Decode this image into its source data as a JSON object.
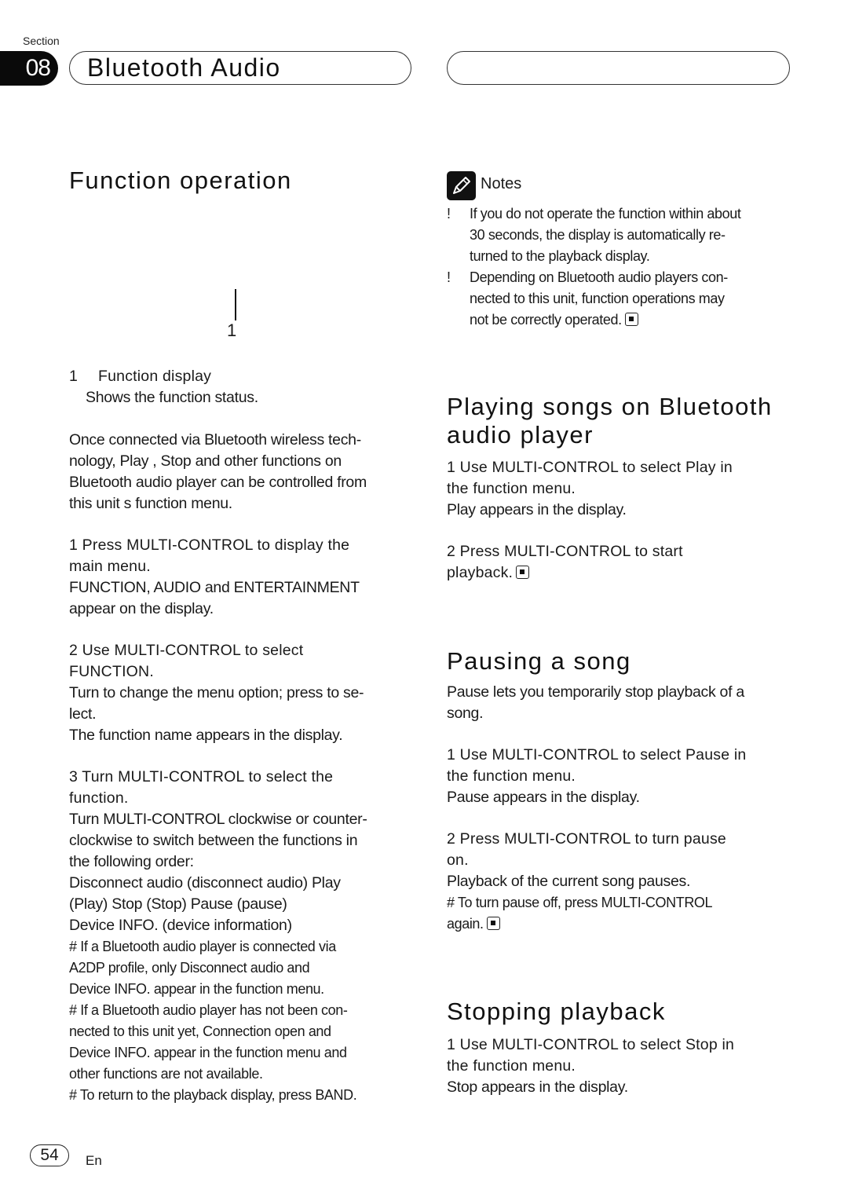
{
  "header": {
    "section_label": "Section",
    "section_number": "08",
    "title": "Bluetooth Audio"
  },
  "left": {
    "heading": "Function operation",
    "figure_callout": "1",
    "legend": {
      "number": "1",
      "label": "Function display",
      "description": "Shows the function status."
    },
    "intro": [
      "Once connected via Bluetooth wireless tech-",
      "nology,  Play ,  Stop  and other functions on",
      "Bluetooth audio player can be controlled from",
      "this unit s function menu."
    ],
    "step1": {
      "lines": [
        "1    Press MULTI-CONTROL to display the",
        "main menu."
      ],
      "desc": [
        "FUNCTION, AUDIO and ENTERTAINMENT",
        "appear on the display."
      ]
    },
    "step2": {
      "lines": [
        "2    Use MULTI-CONTROL to select",
        "FUNCTION."
      ],
      "desc": [
        "Turn to change the menu option; press to se-",
        "lect.",
        "The function name appears in the display."
      ]
    },
    "step3": {
      "lines": [
        "3    Turn MULTI-CONTROL to select the",
        "function."
      ],
      "desc": [
        "Turn MULTI-CONTROL clockwise or counter-",
        "clockwise to switch between the functions in",
        "the following order:",
        "Disconnect audio (disconnect audio)    Play",
        "(Play)    Stop (Stop)    Pause (pause)",
        "Device INFO. (device information)"
      ]
    },
    "tips": [
      "#   If a Bluetooth audio player is connected via",
      "A2DP profile, only Disconnect audio and",
      "Device INFO. appear in the function menu.",
      "#   If a Bluetooth audio player has not been con-",
      "nected to this unit yet, Connection open and",
      "Device INFO. appear in the function menu and",
      "other functions are not available.",
      "#   To return to the playback display, press BAND."
    ]
  },
  "right": {
    "notes": {
      "title": "Notes",
      "icon": "pencil-icon",
      "bullet": "!",
      "items": [
        [
          "If you do not operate the function within about",
          "30 seconds, the display is automatically re-",
          "turned to the playback display."
        ],
        [
          "Depending on Bluetooth audio players con-",
          "nected to this unit, function operations may",
          "not be correctly operated."
        ]
      ]
    },
    "playing": {
      "heading": [
        "Playing songs on Bluetooth",
        "audio player"
      ],
      "step1": [
        "1    Use MULTI-CONTROL to select Play in",
        "the function menu."
      ],
      "step1_desc": "Play appears in the display.",
      "step2": [
        "2    Press MULTI-CONTROL to start",
        "playback."
      ]
    },
    "pausing": {
      "heading": "Pausing a song",
      "intro": [
        "Pause lets you temporarily stop playback of a",
        "song."
      ],
      "step1": [
        "1    Use MULTI-CONTROL to select Pause in",
        "the function menu."
      ],
      "step1_desc": "Pause appears in the display.",
      "step2": [
        "2    Press MULTI-CONTROL to turn pause",
        "on."
      ],
      "step2_desc": "Playback of the current song pauses.",
      "tip": [
        "#   To turn pause off, press MULTI-CONTROL",
        "again."
      ]
    },
    "stopping": {
      "heading": "Stopping playback",
      "step1": [
        "1    Use MULTI-CONTROL to select Stop in",
        "the function menu."
      ],
      "step1_desc": "Stop appears in the display."
    }
  },
  "footer": {
    "page_number": "54",
    "language": "En"
  }
}
